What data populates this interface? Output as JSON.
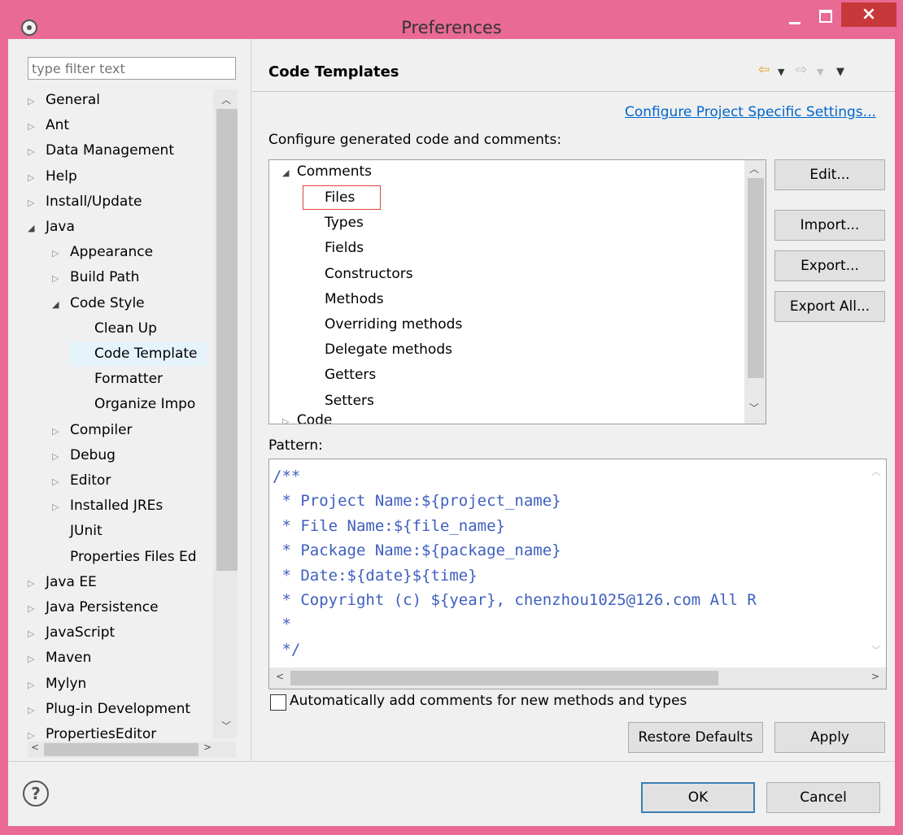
{
  "window": {
    "title": "Preferences",
    "close_glyph": "×"
  },
  "left": {
    "filter_placeholder": "type filter text",
    "tree": [
      {
        "label": "General",
        "level": 0,
        "state": "collapsed"
      },
      {
        "label": "Ant",
        "level": 0,
        "state": "collapsed"
      },
      {
        "label": "Data Management",
        "level": 0,
        "state": "collapsed"
      },
      {
        "label": "Help",
        "level": 0,
        "state": "collapsed"
      },
      {
        "label": "Install/Update",
        "level": 0,
        "state": "collapsed"
      },
      {
        "label": "Java",
        "level": 0,
        "state": "expanded"
      },
      {
        "label": "Appearance",
        "level": 1,
        "state": "collapsed"
      },
      {
        "label": "Build Path",
        "level": 1,
        "state": "collapsed"
      },
      {
        "label": "Code Style",
        "level": 1,
        "state": "expanded"
      },
      {
        "label": "Clean Up",
        "level": 2,
        "state": "leaf"
      },
      {
        "label": "Code Template",
        "level": 2,
        "state": "leaf",
        "selected": true
      },
      {
        "label": "Formatter",
        "level": 2,
        "state": "leaf"
      },
      {
        "label": "Organize Impo",
        "level": 2,
        "state": "leaf"
      },
      {
        "label": "Compiler",
        "level": 1,
        "state": "collapsed"
      },
      {
        "label": "Debug",
        "level": 1,
        "state": "collapsed"
      },
      {
        "label": "Editor",
        "level": 1,
        "state": "collapsed"
      },
      {
        "label": "Installed JREs",
        "level": 1,
        "state": "collapsed"
      },
      {
        "label": "JUnit",
        "level": 1,
        "state": "leaf"
      },
      {
        "label": "Properties Files Ed",
        "level": 1,
        "state": "leaf"
      },
      {
        "label": "Java EE",
        "level": 0,
        "state": "collapsed"
      },
      {
        "label": "Java Persistence",
        "level": 0,
        "state": "collapsed"
      },
      {
        "label": "JavaScript",
        "level": 0,
        "state": "collapsed"
      },
      {
        "label": "Maven",
        "level": 0,
        "state": "collapsed"
      },
      {
        "label": "Mylyn",
        "level": 0,
        "state": "collapsed"
      },
      {
        "label": "Plug-in Development",
        "level": 0,
        "state": "collapsed"
      },
      {
        "label": "PropertiesEditor",
        "level": 0,
        "state": "collapsed"
      }
    ]
  },
  "page": {
    "title": "Code Templates",
    "project_link": "Configure Project Specific Settings...",
    "configure_label": "Configure generated code and comments:",
    "templates": {
      "group": "Comments",
      "items": [
        "Files",
        "Types",
        "Fields",
        "Constructors",
        "Methods",
        "Overriding methods",
        "Delegate methods",
        "Getters",
        "Setters"
      ],
      "next_group": "Code"
    },
    "buttons": {
      "edit": "Edit...",
      "import": "Import...",
      "export": "Export...",
      "export_all": "Export All..."
    },
    "pattern_label": "Pattern:",
    "pattern_lines": [
      "/**",
      " * Project Name:${project_name}",
      " * File Name:${file_name}",
      " * Package Name:${package_name}",
      " * Date:${date}${time}",
      " * Copyright (c) ${year}, chenzhou1025@126.com All R",
      " *",
      " */"
    ],
    "auto_comment_label": "Automatically add comments for new methods and types",
    "auto_comment_checked": false,
    "restore_defaults": "Restore Defaults",
    "apply": "Apply"
  },
  "footer": {
    "ok": "OK",
    "cancel": "Cancel",
    "help_glyph": "?"
  },
  "icons": {
    "back": "back-arrow-icon",
    "forward": "forward-arrow-icon",
    "menu": "view-menu-icon",
    "tree_collapsed": "▷",
    "tree_expanded": "◢"
  },
  "colors": {
    "titlebar": "#e86a95",
    "close": "#c7383a",
    "link": "#0066cc",
    "code": "#3f5fbf",
    "selection_outline": "#e0443c"
  }
}
